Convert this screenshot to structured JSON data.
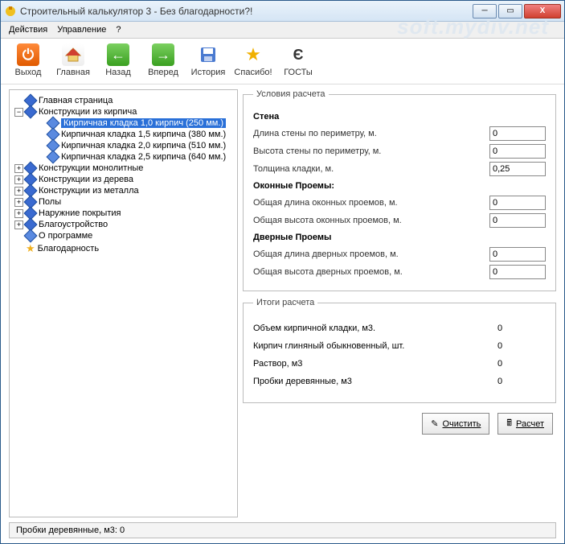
{
  "window": {
    "title": "Строительный калькулятор 3 - Без благодарности?!"
  },
  "menu": {
    "actions": "Действия",
    "manage": "Управление",
    "help": "?"
  },
  "toolbar": {
    "exit": "Выход",
    "home": "Главная",
    "back": "Назад",
    "forward": "Вперед",
    "history": "История",
    "thanks": "Спасибо!",
    "gosts": "ГОСТы"
  },
  "tree": {
    "home": "Главная страница",
    "brick": {
      "label": "Конструкции из кирпича",
      "items": [
        "Кирпичная кладка 1,0 кирпич (250 мм.)",
        "Кирпичная кладка 1,5 кирпича (380 мм.)",
        "Кирпичная кладка 2,0 кирпича  (510 мм.)",
        "Кирпичная кладка 2,5 кирпича  (640 мм.)"
      ]
    },
    "mono": "Конструкции монолитные",
    "wood": "Конструкции из дерева",
    "metal": "Конструкции из металла",
    "floors": "Полы",
    "exterior": "Наружние покрытия",
    "landscaping": "Благоустройство",
    "about": "О программе",
    "gratitude": "Благодарность"
  },
  "calc": {
    "legend": "Условия расчета",
    "wall": {
      "title": "Стена",
      "len_label": "Длина стены по периметру, м.",
      "len_val": "0",
      "h_label": "Высота стены по периметру, м.",
      "h_val": "0",
      "t_label": "Толщина кладки, м.",
      "t_val": "0,25"
    },
    "windows": {
      "title": "Оконные Проемы:",
      "len_label": "Общая длина оконных проемов, м.",
      "len_val": "0",
      "h_label": "Общая высота оконных проемов, м.",
      "h_val": "0"
    },
    "doors": {
      "title": "Дверные Проемы",
      "len_label": "Общая длина дверных проемов, м.",
      "len_val": "0",
      "h_label": "Общая высота дверных проемов, м.",
      "h_val": "0"
    }
  },
  "results": {
    "legend": "Итоги расчета",
    "r1_label": "Объем кирпичной кладки, м3.",
    "r1_val": "0",
    "r2_label": "Кирпич глиняный обыкновенный, шт.",
    "r2_val": "0",
    "r3_label": "Раствор, м3",
    "r3_val": "0",
    "r4_label": "Пробки деревянные, м3",
    "r4_val": "0"
  },
  "buttons": {
    "clear": "Очистить",
    "calc": "Расчет"
  },
  "status": "Пробки деревянные, м3: 0",
  "watermark": "soft.mydiv.net"
}
